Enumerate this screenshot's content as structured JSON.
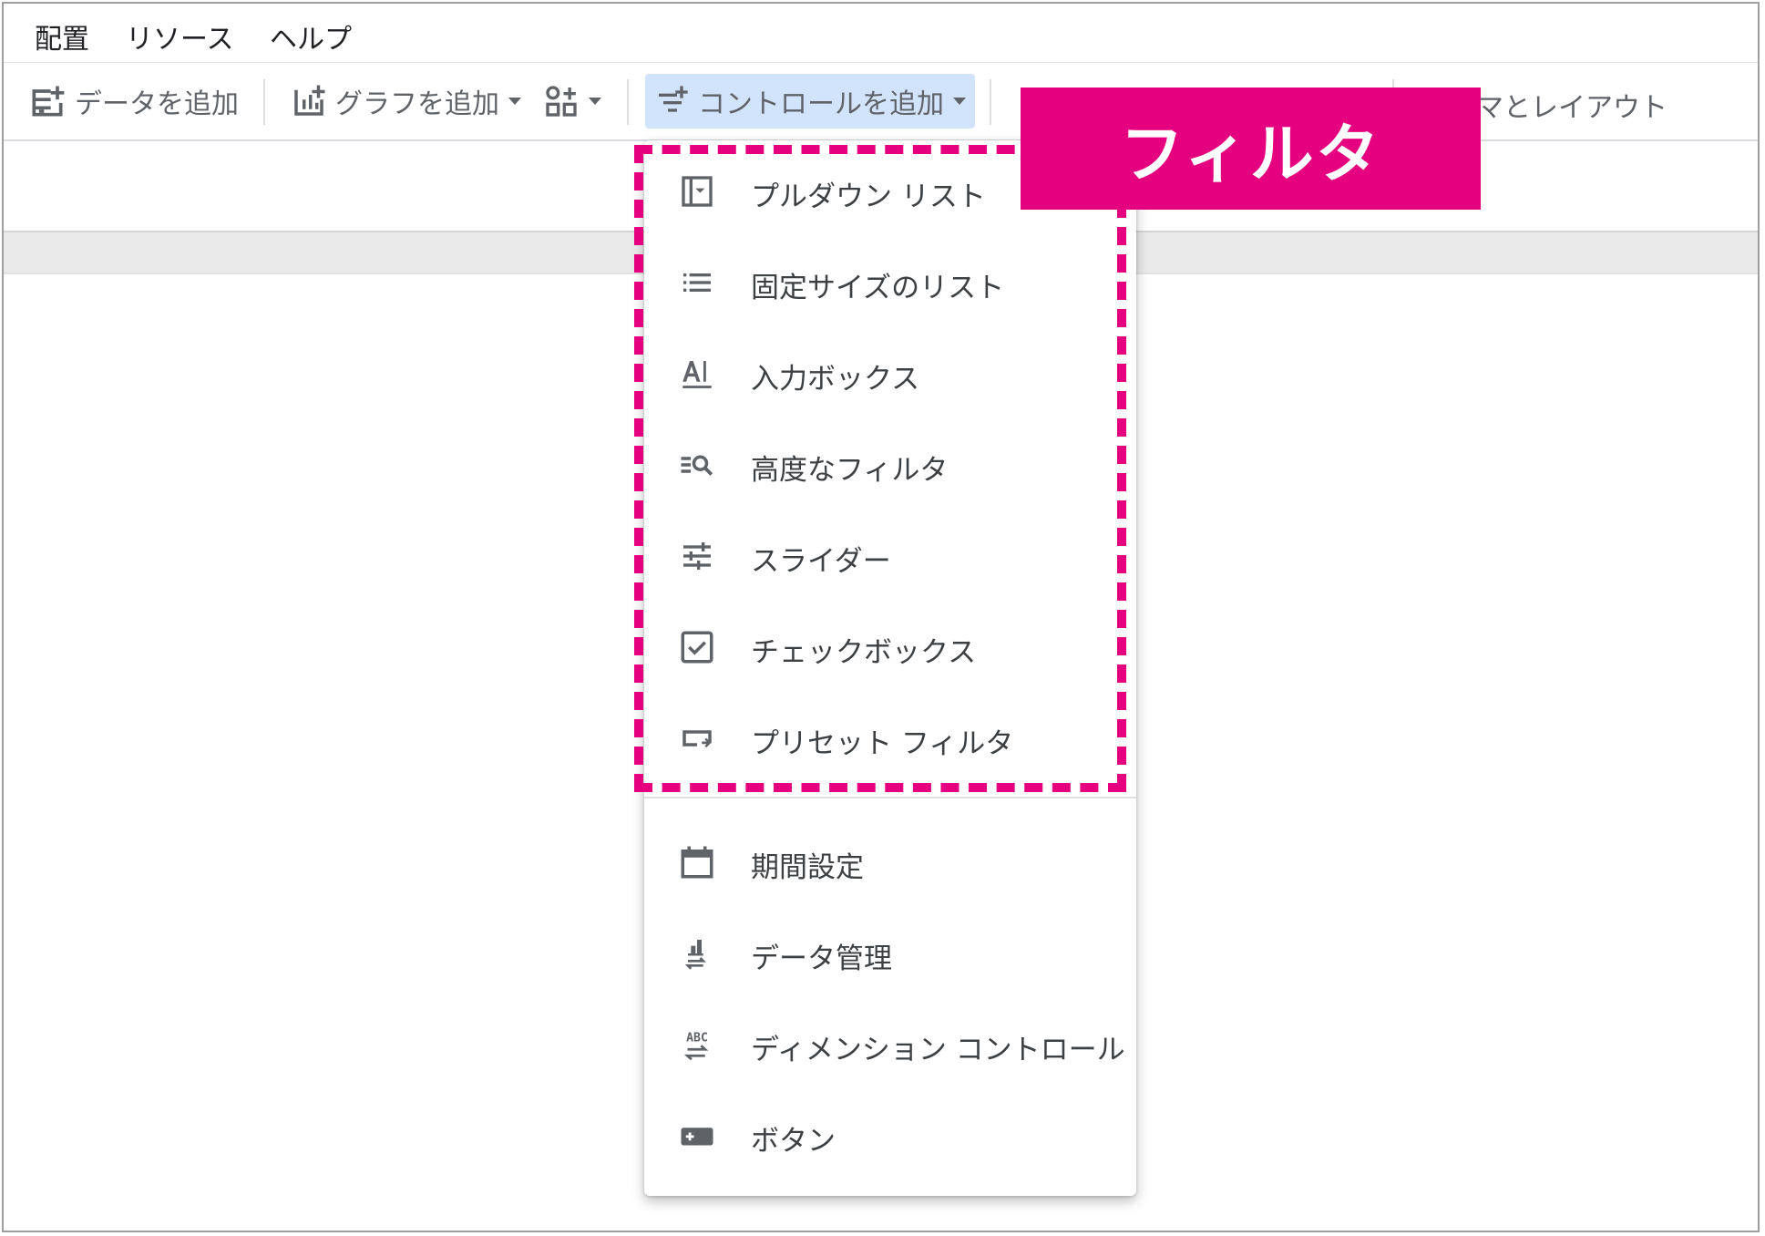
{
  "menubar": {
    "items": [
      "配置",
      "リソース",
      "ヘルプ"
    ]
  },
  "toolbar": {
    "add_data": "データを追加",
    "add_chart": "グラフを追加",
    "add_control": "コントロールを追加",
    "theme_layout_partial": "マとレイアウト"
  },
  "menu": {
    "filter_items": [
      {
        "label": "プルダウン リスト",
        "icon": "dropdown-list-icon"
      },
      {
        "label": "固定サイズのリスト",
        "icon": "fixed-list-icon"
      },
      {
        "label": "入力ボックス",
        "icon": "input-box-icon"
      },
      {
        "label": "高度なフィルタ",
        "icon": "advanced-filter-icon"
      },
      {
        "label": "スライダー",
        "icon": "slider-icon"
      },
      {
        "label": "チェックボックス",
        "icon": "checkbox-icon"
      },
      {
        "label": "プリセット フィルタ",
        "icon": "preset-filter-icon"
      }
    ],
    "other_items": [
      {
        "label": "期間設定",
        "icon": "calendar-icon"
      },
      {
        "label": "データ管理",
        "icon": "data-control-icon"
      },
      {
        "label": "ディメンション コントロール",
        "icon": "dimension-control-icon"
      },
      {
        "label": "ボタン",
        "icon": "button-icon"
      }
    ]
  },
  "annotation": {
    "label": "フィルタ",
    "color": "#e4007f"
  }
}
